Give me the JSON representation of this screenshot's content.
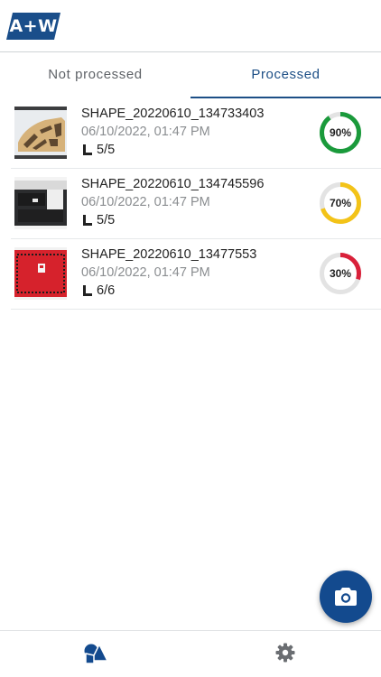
{
  "header": {
    "logo_text": "A+W",
    "logo_color": "#1a4e8a"
  },
  "tabs": [
    {
      "label": "Not processed",
      "active": false
    },
    {
      "label": "Processed",
      "active": true
    }
  ],
  "items": [
    {
      "name": "SHAPE_20220610_134733403",
      "date": "06/10/2022, 01:47 PM",
      "count": "5/5",
      "progress_percent": 90,
      "progress_label": "90%",
      "progress_color": "#1a9a3b",
      "thumbnail_icon": "wood-shape-photo"
    },
    {
      "name": "SHAPE_20220610_134745596",
      "date": "06/10/2022, 01:47 PM",
      "count": "5/5",
      "progress_percent": 70,
      "progress_label": "70%",
      "progress_color": "#f3c318",
      "thumbnail_icon": "dark-shape-photo"
    },
    {
      "name": "SHAPE_20220610_13477553",
      "date": "06/10/2022, 01:47 PM",
      "count": "6/6",
      "progress_percent": 30,
      "progress_label": "30%",
      "progress_color": "#d9213a",
      "thumbnail_icon": "red-shape-photo"
    }
  ],
  "fab": {
    "icon": "camera-icon",
    "color": "#134a8e"
  },
  "bottom_nav": [
    {
      "icon": "shapes-icon",
      "active": true,
      "color": "#134a8e"
    },
    {
      "icon": "gear-icon",
      "active": false,
      "color": "#6b6e72"
    }
  ],
  "colors": {
    "accent": "#1d4f86",
    "gauge_track": "#e3e3e3",
    "secondary_text": "#8a8d90"
  }
}
